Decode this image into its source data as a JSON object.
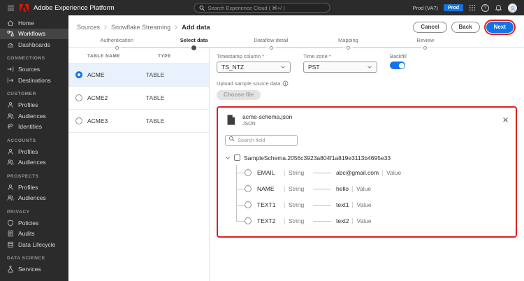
{
  "topbar": {
    "app_title": "Adobe Experience Platform",
    "search_placeholder": "Search Experience Cloud ( ⌘+/ )",
    "environment": "Prod (VA7)",
    "environment_badge": "Prod"
  },
  "sidebar": {
    "groups": [
      {
        "title": "",
        "items": [
          "Home",
          "Workflows",
          "Dashboards"
        ]
      },
      {
        "title": "CONNECTIONS",
        "items": [
          "Sources",
          "Destinations"
        ]
      },
      {
        "title": "CUSTOMER",
        "items": [
          "Profiles",
          "Audiences",
          "Identities"
        ]
      },
      {
        "title": "ACCOUNTS",
        "items": [
          "Profiles",
          "Audiences"
        ]
      },
      {
        "title": "PROSPECTS",
        "items": [
          "Profiles",
          "Audiences"
        ]
      },
      {
        "title": "PRIVACY",
        "items": [
          "Policies",
          "Audits",
          "Data Lifecycle"
        ]
      },
      {
        "title": "DATA SCIENCE",
        "items": [
          "Services"
        ]
      }
    ],
    "active_item": "Workflows"
  },
  "breadcrumb": {
    "items": [
      "Sources",
      "Snowflake Streaming",
      "Add data"
    ]
  },
  "header_actions": {
    "cancel": "Cancel",
    "back": "Back",
    "next": "Next"
  },
  "stepper": {
    "steps": [
      "Authentication",
      "Select data",
      "Dataflow detail",
      "Mapping",
      "Review"
    ],
    "active_step": "Select data"
  },
  "table": {
    "columns": [
      "TABLE NAME",
      "TYPE"
    ],
    "rows": [
      {
        "name": "ACME",
        "type": "TABLE",
        "selected": true
      },
      {
        "name": "ACME2",
        "type": "TABLE",
        "selected": false
      },
      {
        "name": "ACME3",
        "type": "TABLE",
        "selected": false
      }
    ]
  },
  "form": {
    "timestamp": {
      "label": "Timestamp column",
      "required_marker": "*",
      "value": "TS_NTZ"
    },
    "timezone": {
      "label": "Time zone",
      "required_marker": "*",
      "value": "PST"
    },
    "backfill": {
      "label": "Backfill",
      "enabled": true
    },
    "upload_label": "Upload sample source data",
    "choose_file_button": "Choose file"
  },
  "preview": {
    "file_name": "acme-schema.json",
    "file_type": "JSON",
    "search_placeholder": "Search field",
    "root_node": "SampleSchema.2056c3923a804f1a819e3113b4695e33",
    "fields": [
      {
        "name": "EMAIL",
        "type": "String",
        "value": "abc@gmail.com",
        "value_label": "Value"
      },
      {
        "name": "NAME",
        "type": "String",
        "value": "hello",
        "value_label": "Value"
      },
      {
        "name": "TEXT1",
        "type": "String",
        "value": "text1",
        "value_label": "Value"
      },
      {
        "name": "TEXT2",
        "type": "String",
        "value": "text2",
        "value_label": "Value"
      }
    ]
  },
  "colors": {
    "accent_blue": "#1473e6",
    "adobe_red": "#fa0f00",
    "annotation_red": "#e02020"
  }
}
